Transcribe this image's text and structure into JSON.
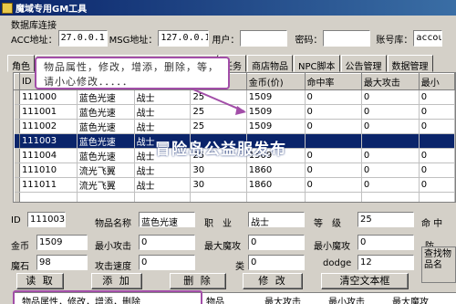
{
  "window": {
    "title": "魔域专用GM工具"
  },
  "db": {
    "legend": "数据库连接",
    "acc_label": "ACC地址：",
    "acc_value": "27.0.0.1",
    "msg_label": "MSG地址：",
    "msg_value": "127.0.0.1",
    "user_label": "用户：",
    "user_value": "",
    "password_label": "密码：",
    "password_value": "",
    "account_db_label": "账号库：",
    "account_db_value": "account"
  },
  "tabs": [
    "角色",
    "",
    "",
    "",
    "",
    "任务",
    "商店物品",
    "NPC脚本",
    "公告管理",
    "数据管理"
  ],
  "callout": {
    "text": "物品属性，修改，增添，删除，等，请小心修改．．．．．"
  },
  "watermark": "冒险岛公益服发布",
  "grid": {
    "columns": [
      "ID",
      "",
      "",
      "",
      "金币(价)",
      "命中率",
      "最大攻击",
      "最小"
    ],
    "rows": [
      [
        "111000",
        "蓝色光速",
        "战士",
        "25",
        "1509",
        "0",
        "0",
        "0"
      ],
      [
        "111001",
        "蓝色光速",
        "战士",
        "25",
        "1509",
        "0",
        "0",
        "0"
      ],
      [
        "111002",
        "蓝色光速",
        "战士",
        "25",
        "1509",
        "0",
        "0",
        "0"
      ],
      [
        "111003",
        "蓝色光速",
        "战士",
        "",
        "",
        "",
        "",
        ""
      ],
      [
        "111004",
        "蓝色光速",
        "战士",
        "25",
        "1509",
        "0",
        "0",
        "0"
      ],
      [
        "111010",
        "流光飞翼",
        "战士",
        "30",
        "1860",
        "0",
        "0",
        "0"
      ],
      [
        "111011",
        "流光飞翼",
        "战士",
        "30",
        "1860",
        "0",
        "0",
        "0"
      ],
      [
        "",
        "",
        "",
        "",
        "",
        "",
        "",
        ""
      ]
    ]
  },
  "form": {
    "id_label": "ID",
    "id_value": "111003",
    "name_label": "物品名称",
    "name_value": "蓝色光速",
    "job_label": "职　业",
    "job_value": "战士",
    "level_label": "等　级",
    "level_value": "25",
    "hit_label": "命 中",
    "gold_label": "金币",
    "gold_value": "1509",
    "min_atk_label": "最小攻击",
    "min_atk_value": "0",
    "max_matk_label": "最大魔攻",
    "max_matk_value": "0",
    "min_matk_label": "最小魔攻",
    "min_matk_value": "0",
    "def_label": "防",
    "stone_label": "魔石",
    "stone_value": "98",
    "atk_speed_label": "攻击速度",
    "atk_speed_value": "0",
    "class_label": "类",
    "class_value": "0",
    "dodge_label": "dodge",
    "dodge_value": "12"
  },
  "buttons": {
    "read": "读 取",
    "add": "添 加",
    "delete": "删 除",
    "modify": "修 改",
    "clear": "清空文本框"
  },
  "side_box": {
    "text": "查找物品名"
  },
  "bottom": {
    "highlight_text": "物品属性，修改，增添，删除",
    "cols": [
      "物品",
      "最大攻击",
      "最小攻击",
      "最大魔攻"
    ]
  }
}
